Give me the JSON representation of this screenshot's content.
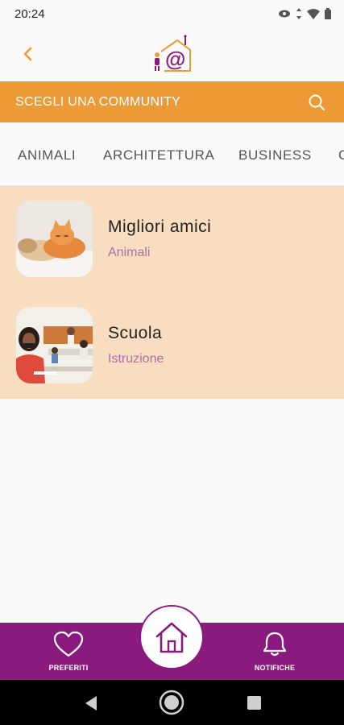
{
  "status_bar": {
    "time": "20:24"
  },
  "header": {
    "back_icon": "chevron-left-icon",
    "logo_icon": "house-at-logo-icon"
  },
  "search": {
    "label": "SCEGLI UNA COMMUNITY",
    "icon": "search-icon"
  },
  "tabs": [
    {
      "label": "ANIMALI"
    },
    {
      "label": "ARCHITETTURA"
    },
    {
      "label": "BUSINESS"
    },
    {
      "label": "C"
    }
  ],
  "communities": [
    {
      "title": "Migliori amici",
      "category": "Animali"
    },
    {
      "title": "Scuola",
      "category": "Istruzione"
    }
  ],
  "bottom_nav": {
    "left": {
      "label": "PREFERITI",
      "icon": "heart-icon"
    },
    "center": {
      "icon": "home-icon"
    },
    "right": {
      "label": "NOTIFICHE",
      "icon": "bell-icon"
    }
  },
  "colors": {
    "accent_orange": "#eb9a35",
    "list_bg": "#f8ddc0",
    "brand_purple": "#8b1a7e",
    "category_text": "#b06ea8"
  }
}
